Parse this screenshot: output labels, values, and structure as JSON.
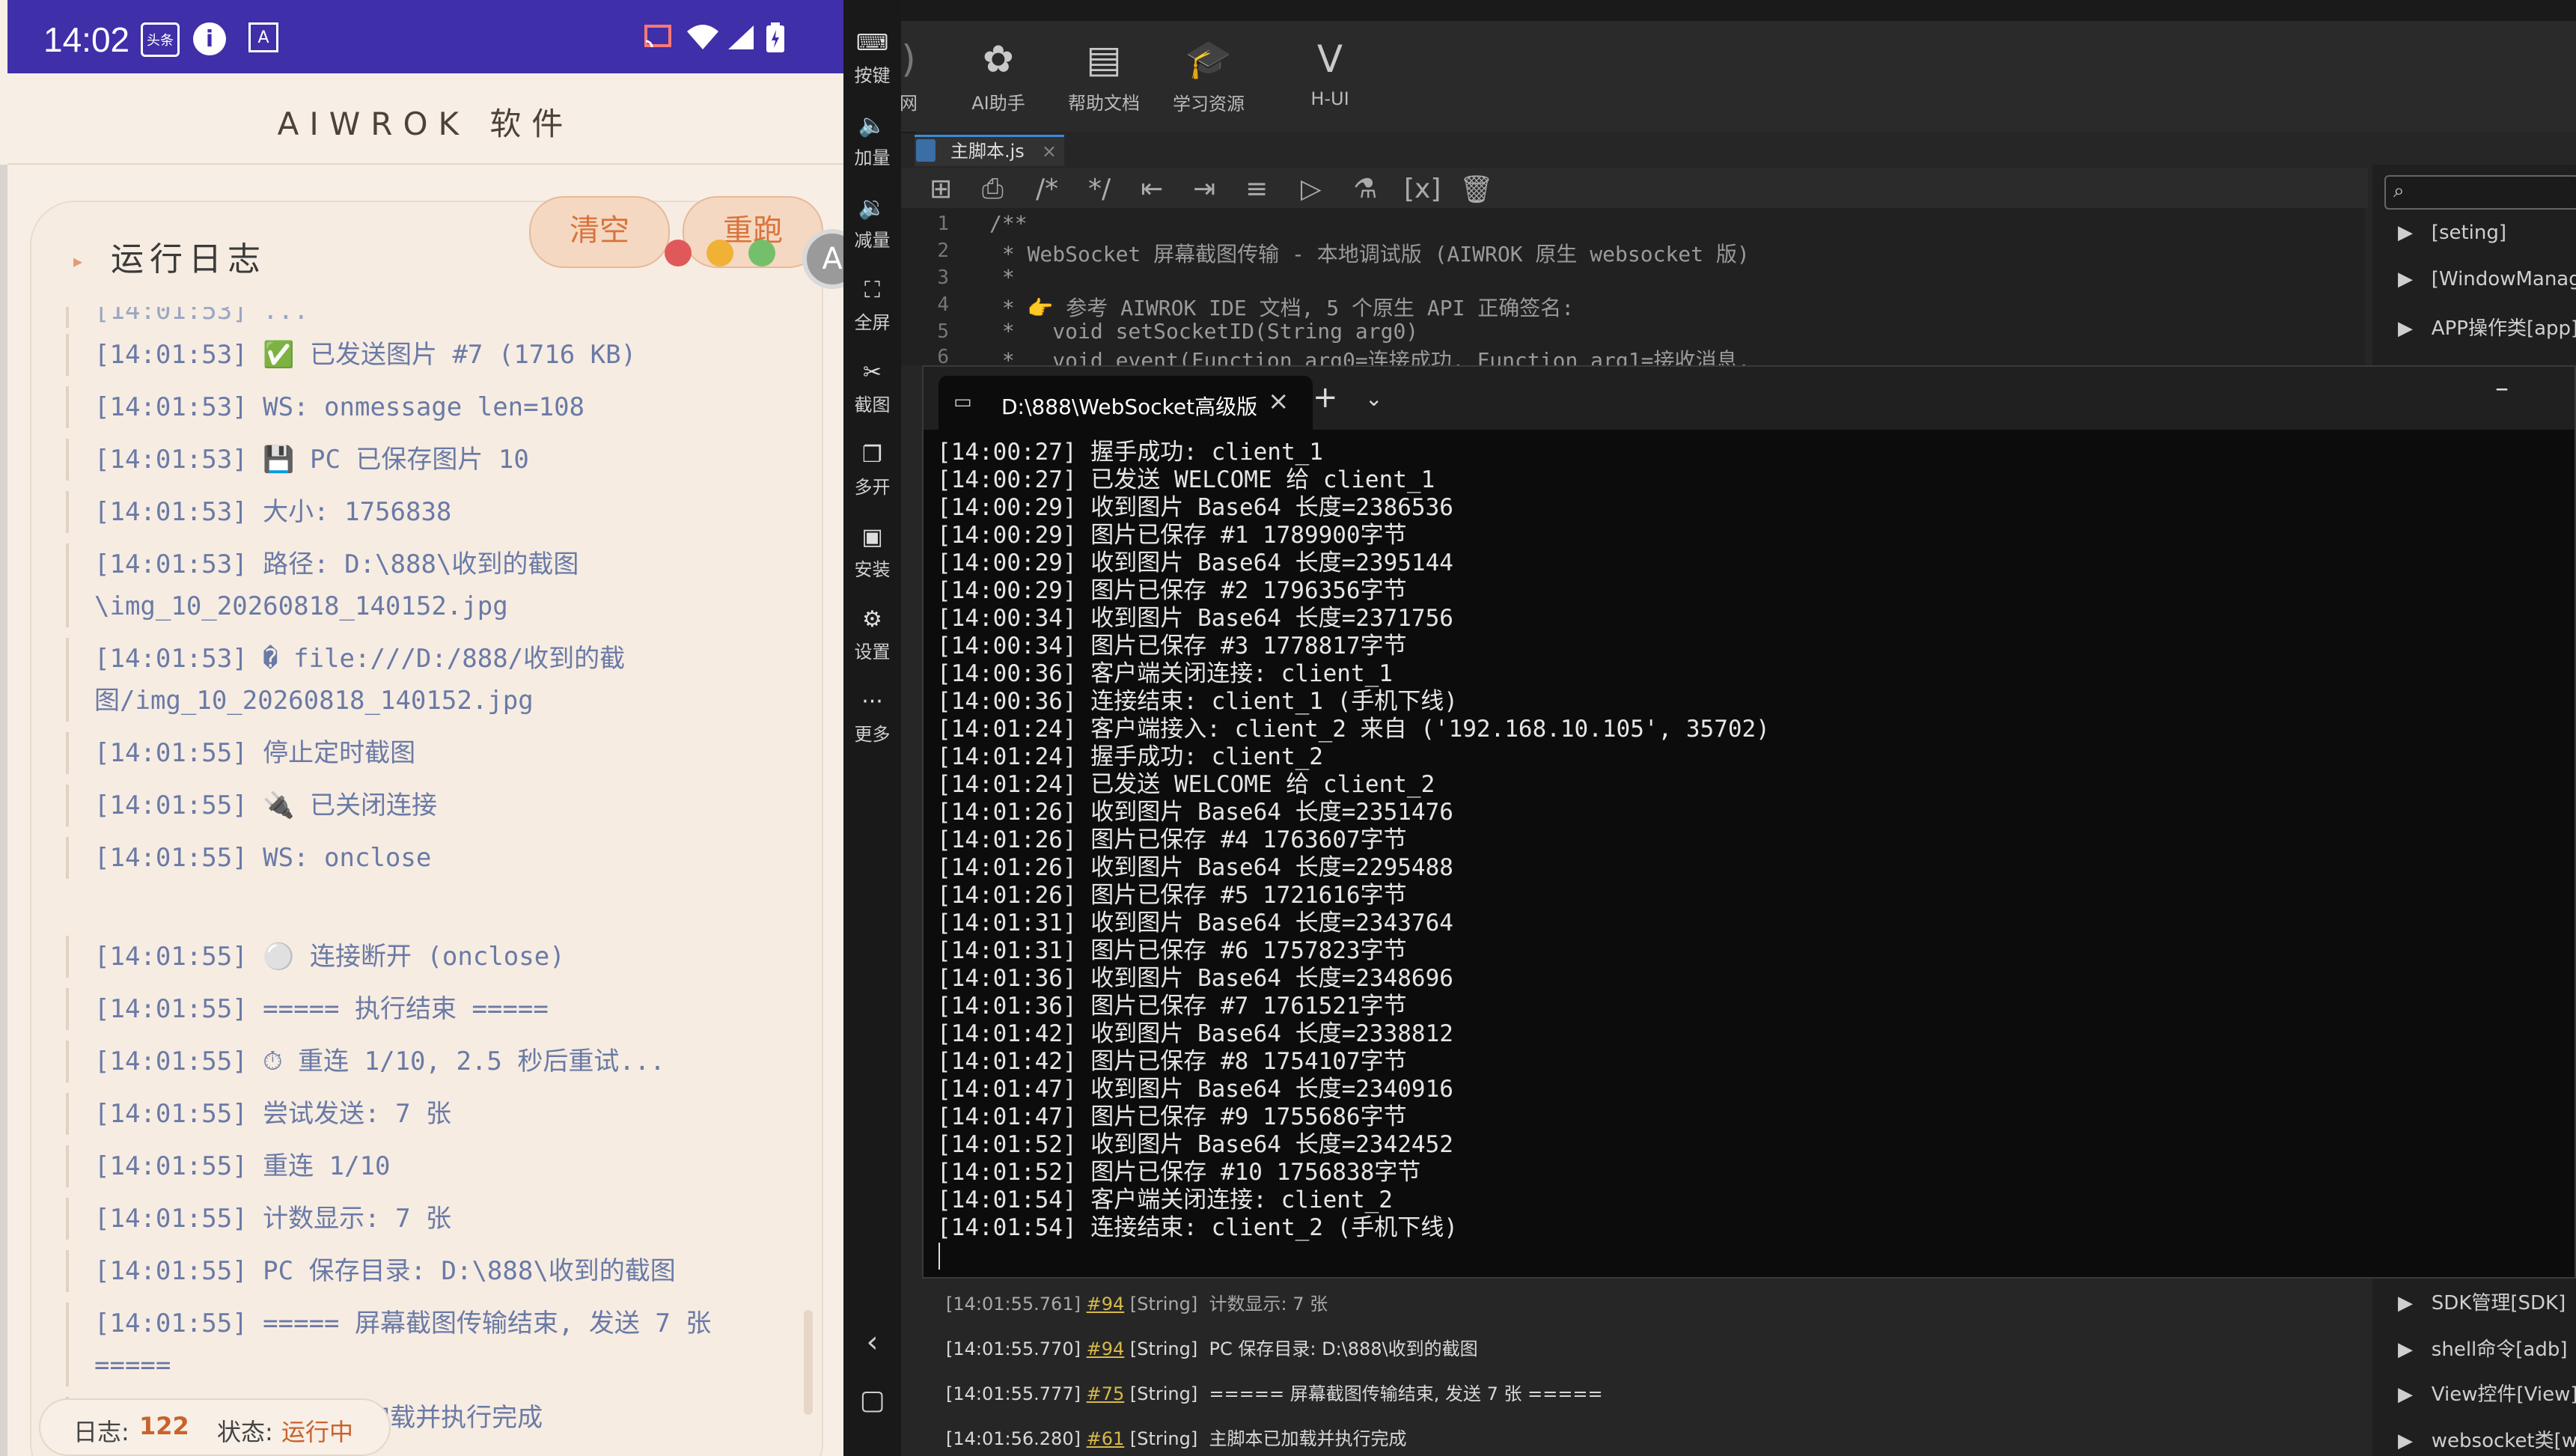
{
  "phone": {
    "status": {
      "time": "14:02",
      "ind1": "头条",
      "ind2": "i",
      "ind3": "A"
    },
    "app_title": "AIWROK 软件",
    "log_title": "运行日志",
    "btn_clear": "清空",
    "btn_rerun": "重跑",
    "logs": [
      {
        "text": "[14:01:53] ✅ 已发送图片 #7 (1716 KB)"
      },
      {
        "text": "[14:01:53] WS: onmessage len=108"
      },
      {
        "text": "[14:01:53] 💾 PC 已保存图片 10"
      },
      {
        "text": "[14:01:53] 大小: 1756838"
      },
      {
        "text": "[14:01:53] 路径: D:\\888\\收到的截图\\img_10_20260818_140152.jpg"
      },
      {
        "text": "[14:01:53] � file:///D:/888/收到的截图/img_10_20260818_140152.jpg"
      },
      {
        "text": "[14:01:55] 停止定时截图"
      },
      {
        "text": "[14:01:55] 🔌 已关闭连接"
      },
      {
        "text": "[14:01:55] WS: onclose"
      },
      {
        "text": "[14:01:55] ⚪ 连接断开 (onclose)"
      },
      {
        "text": "[14:01:55] ===== 执行结束 ====="
      },
      {
        "text": "[14:01:55] ⏱ 重连 1/10, 2.5 秒后重试..."
      },
      {
        "text": "[14:01:55] 尝试发送: 7 张"
      },
      {
        "text": "[14:01:55] 重连 1/10"
      },
      {
        "text": "[14:01:55] 计数显示: 7 张"
      },
      {
        "text": "[14:01:55] PC 保存目录: D:\\888\\收到的截图"
      },
      {
        "text": "[14:01:55] ===== 屏幕截图传输结束, 发送 7 张 ====="
      },
      {
        "text": "[14:01:56] 主脚本已加载并执行完成"
      }
    ],
    "bottom": {
      "log_label": "日志:",
      "log_count": "122",
      "state_label": "状态:",
      "state_value": "运行中"
    }
  },
  "sidebar": [
    {
      "icon": "keyboard-icon",
      "label": "按键"
    },
    {
      "icon": "volume-up-icon",
      "label": "加量"
    },
    {
      "icon": "volume-down-icon",
      "label": "减量"
    },
    {
      "icon": "fullscreen-icon",
      "label": "全屏"
    },
    {
      "icon": "scissors-icon",
      "label": "截图"
    },
    {
      "icon": "multi-window-icon",
      "label": "多开"
    },
    {
      "icon": "install-icon",
      "label": "安装"
    },
    {
      "icon": "settings-icon",
      "label": "设置"
    },
    {
      "icon": "more-icon",
      "label": "更多"
    }
  ],
  "ide": {
    "toolbar": [
      {
        "icon": "openai-icon",
        "label": "AI助手"
      },
      {
        "icon": "document-icon",
        "label": "帮助文档"
      },
      {
        "icon": "graduation-cap-icon",
        "label": "学习资源"
      },
      {
        "icon": "v-logo-icon",
        "label": "H-UI"
      }
    ],
    "toolbar_partial": "网",
    "tab_label": "主脚本.js",
    "code": [
      {
        "n": "1",
        "t": "/**"
      },
      {
        "n": "2",
        "t": " * WebSocket 屏幕截图传输 - 本地调试版 (AIWROK 原生 websocket 版)"
      },
      {
        "n": "3",
        "t": " *"
      },
      {
        "n": "4",
        "t": " * 👉 参考 AIWROK IDE 文档, 5 个原生 API 正确签名:"
      },
      {
        "n": "5",
        "t": " *   void setSocketID(String arg0)"
      },
      {
        "n": "6",
        "t": " *   void event(Function arg0=连接成功, Function arg1=接收消息,"
      }
    ],
    "tree": [
      "[seting]",
      "[WindowManage",
      "APP操作类[app]"
    ],
    "tree_bottom": [
      "SDK管理[SDK]",
      "shell命令[adb]",
      "View控件[View]",
      "websocket类[we"
    ],
    "console": [
      {
        "time": "[14:01:55.761]",
        "ref": "#94",
        "type": "[String]",
        "msg": "计数显示: 7 张"
      },
      {
        "time": "[14:01:55.770]",
        "ref": "#94",
        "type": "[String]",
        "msg": "PC 保存目录: D:\\888\\收到的截图"
      },
      {
        "time": "[14:01:55.777]",
        "ref": "#75",
        "type": "[String]",
        "msg": "===== 屏幕截图传输结束, 发送 7 张 ====="
      },
      {
        "time": "[14:01:56.280]",
        "ref": "#61",
        "type": "[String]",
        "msg": "主脚本已加载并执行完成"
      }
    ]
  },
  "terminal": {
    "title": "D:\\888\\WebSocket高级版",
    "lines": [
      "[14:00:27] 握手成功: client_1",
      "[14:00:27] 已发送 WELCOME 给 client_1",
      "[14:00:29] 收到图片 Base64 长度=2386536",
      "[14:00:29] 图片已保存 #1 1789900字节",
      "[14:00:29] 收到图片 Base64 长度=2395144",
      "[14:00:29] 图片已保存 #2 1796356字节",
      "[14:00:34] 收到图片 Base64 长度=2371756",
      "[14:00:34] 图片已保存 #3 1778817字节",
      "[14:00:36] 客户端关闭连接: client_1",
      "[14:00:36] 连接结束: client_1 (手机下线)",
      "[14:01:24] 客户端接入: client_2 来自 ('192.168.10.105', 35702)",
      "[14:01:24] 握手成功: client_2",
      "[14:01:24] 已发送 WELCOME 给 client_2",
      "[14:01:26] 收到图片 Base64 长度=2351476",
      "[14:01:26] 图片已保存 #4 1763607字节",
      "[14:01:26] 收到图片 Base64 长度=2295488",
      "[14:01:26] 图片已保存 #5 1721616字节",
      "[14:01:31] 收到图片 Base64 长度=2343764",
      "[14:01:31] 图片已保存 #6 1757823字节",
      "[14:01:36] 收到图片 Base64 长度=2348696",
      "[14:01:36] 图片已保存 #7 1761521字节",
      "[14:01:42] 收到图片 Base64 长度=2338812",
      "[14:01:42] 图片已保存 #8 1754107字节",
      "[14:01:47] 收到图片 Base64 长度=2340916",
      "[14:01:47] 图片已保存 #9 1755686字节",
      "[14:01:52] 收到图片 Base64 长度=2342452",
      "[14:01:52] 图片已保存 #10 1756838字节",
      "[14:01:54] 客户端关闭连接: client_2",
      "[14:01:54] 连接结束: client_2 (手机下线)"
    ]
  }
}
